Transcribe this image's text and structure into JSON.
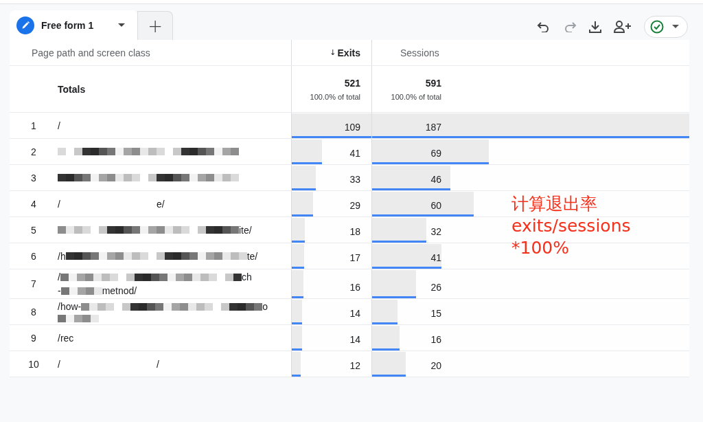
{
  "tabs": [
    {
      "label": "Free form 1",
      "selected": true
    }
  ],
  "add_tab": "+",
  "toolbar": {
    "undo_disabled": false,
    "redo_disabled": true
  },
  "table": {
    "columns": [
      {
        "label": "Page path and screen class",
        "sorted": false
      },
      {
        "label": "Exits",
        "sorted": true,
        "sort_arrow": "↓"
      },
      {
        "label": "Sessions",
        "sorted": false
      }
    ],
    "totals": {
      "label": "Totals",
      "exits": "521",
      "exits_share": "100.0% of total",
      "sessions": "591",
      "sessions_share": "100.0% of total"
    },
    "rows": [
      {
        "rank": "1",
        "path": [
          {
            "kind": "text",
            "text": "/"
          }
        ],
        "exits": {
          "value": "109",
          "level": 1
        },
        "sessions": {
          "value": "187",
          "level": 1
        }
      },
      {
        "rank": "2",
        "path": [
          {
            "kind": "mosaic"
          }
        ],
        "exits": {
          "value": "41",
          "level": 0.376
        },
        "sessions": {
          "value": "69",
          "level": 0.369
        }
      },
      {
        "rank": "3",
        "path": [
          {
            "kind": "mosaic"
          }
        ],
        "exits": {
          "value": "33",
          "level": 0.303
        },
        "sessions": {
          "value": "46",
          "level": 0.246
        }
      },
      {
        "rank": "4",
        "path": [
          {
            "kind": "text",
            "text": "/"
          },
          {
            "kind": "blank"
          },
          {
            "kind": "text",
            "text": "e/"
          }
        ],
        "exits": {
          "value": "29",
          "level": 0.266
        },
        "sessions": {
          "value": "60",
          "level": 0.321
        }
      },
      {
        "rank": "5",
        "path": [
          {
            "kind": "mosaic"
          },
          {
            "kind": "text",
            "text": "ite/"
          }
        ],
        "exits": {
          "value": "18",
          "level": 0.165
        },
        "sessions": {
          "value": "32",
          "level": 0.171
        }
      },
      {
        "rank": "6",
        "path": [
          {
            "kind": "text",
            "text": "/h"
          },
          {
            "kind": "mosaic"
          },
          {
            "kind": "text",
            "text": "te/"
          }
        ],
        "exits": {
          "value": "17",
          "level": 0.156
        },
        "sessions": {
          "value": "41",
          "level": 0.219
        }
      },
      {
        "rank": "7",
        "path": [
          {
            "kind": "text",
            "text": "/"
          },
          {
            "kind": "mosaic"
          },
          {
            "kind": "text",
            "text": "ch"
          },
          {
            "kind": "break"
          },
          {
            "kind": "text",
            "text": "-"
          },
          {
            "kind": "mosaic_short"
          },
          {
            "kind": "text",
            "text": "metnod/"
          }
        ],
        "exits": {
          "value": "16",
          "level": 0.147
        },
        "sessions": {
          "value": "26",
          "level": 0.139
        }
      },
      {
        "rank": "8",
        "path": [
          {
            "kind": "text",
            "text": "/how-"
          },
          {
            "kind": "mosaic"
          },
          {
            "kind": "text",
            "text": "o"
          },
          {
            "kind": "break"
          },
          {
            "kind": "mosaic_short"
          }
        ],
        "exits": {
          "value": "14",
          "level": 0.128
        },
        "sessions": {
          "value": "15",
          "level": 0.08
        }
      },
      {
        "rank": "9",
        "path": [
          {
            "kind": "text",
            "text": "/rec"
          },
          {
            "kind": "blank"
          }
        ],
        "exits": {
          "value": "14",
          "level": 0.128
        },
        "sessions": {
          "value": "16",
          "level": 0.086
        }
      },
      {
        "rank": "10",
        "path": [
          {
            "kind": "text",
            "text": "/"
          },
          {
            "kind": "blank"
          },
          {
            "kind": "text",
            "text": "/"
          }
        ],
        "exits": {
          "value": "12",
          "level": 0.11
        },
        "sessions": {
          "value": "20",
          "level": 0.107
        }
      }
    ]
  },
  "annotation": [
    "计算退出率",
    "exits/sessions",
    "*100%"
  ]
}
